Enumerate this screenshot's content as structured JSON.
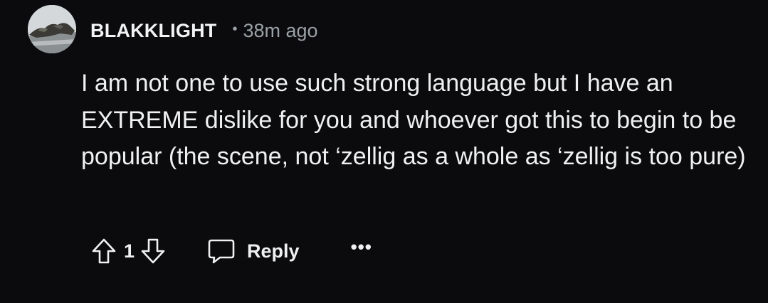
{
  "comment": {
    "author": "BLAKKLIGHT",
    "separator": "•",
    "timestamp": "38m ago",
    "body": "I am not one to use such strong language but I have an EXTREME dislike for you and whoever got this to begin to be popular (the scene, not ‘zellig as a whole as ‘zellig is too pure)",
    "avatar_icon": "avatar-image",
    "actions": {
      "upvote_icon": "arrow-up-outline-icon",
      "vote_count": "1",
      "downvote_icon": "arrow-down-outline-icon",
      "reply_icon": "speech-bubble-icon",
      "reply_label": "Reply",
      "more_label": "•••"
    }
  },
  "colors": {
    "background": "#0b0b0d",
    "text": "#eef0f2",
    "muted": "#9aa1a7"
  }
}
